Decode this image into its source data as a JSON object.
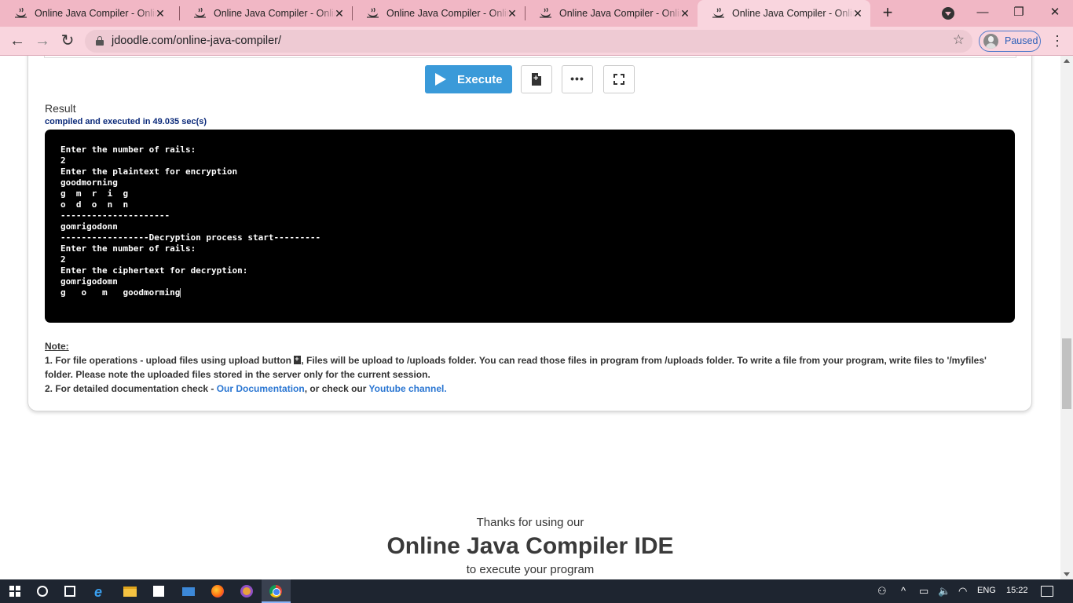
{
  "browser": {
    "tabs": [
      {
        "title": "Online Java Compiler - Online Java IDE",
        "active": false
      },
      {
        "title": "Online Java Compiler - Online Java IDE",
        "active": false
      },
      {
        "title": "Online Java Compiler - Online Java IDE",
        "active": false
      },
      {
        "title": "Online Java Compiler - Online Java IDE",
        "active": false
      },
      {
        "title": "Online Java Compiler - Online Java IDE",
        "active": true
      }
    ],
    "tab_close_glyph": "✕",
    "new_tab_glyph": "+",
    "url": "jdoodle.com/online-java-compiler/",
    "profile_status": "Paused",
    "back_glyph": "←",
    "forward_glyph": "→",
    "reload_glyph": "↻",
    "star_glyph": "☆",
    "menu_glyph": "⋮",
    "minimize_glyph": "—",
    "maximize_glyph": "❐",
    "close_glyph": "✕"
  },
  "toolbar": {
    "execute_label": "Execute",
    "more_glyph": "•••"
  },
  "result": {
    "label": "Result",
    "exec_info": "compiled and executed in 49.035 sec(s)",
    "console_lines": [
      "Enter the number of rails:",
      "2",
      "Enter the plaintext for encryption",
      "goodmorning",
      "g  m  r  i  g",
      "o  d  o  n  n",
      "---------------------",
      "gomrigodonn",
      "-----------------Decryption process start---------",
      "Enter the number of rails:",
      "2",
      "Enter the ciphertext for decryption:",
      "gomrigodomn",
      "g   o   m   goodmorming"
    ]
  },
  "note": {
    "title": "Note:",
    "line1_a": "1. For file operations - upload files using upload button ",
    "line1_b": ", Files will be upload to /uploads folder. You can read those files in program from /uploads folder. To write a file from your program, write files to '/myfiles'",
    "line2": "folder. Please note the uploaded files stored in the server only for the current session.",
    "line3_a": "2. For detailed documentation check - ",
    "line3_link1": "Our Documentation",
    "line3_b": ", or check our ",
    "line3_link2": "Youtube channel."
  },
  "footer": {
    "thanks": "Thanks for using our",
    "title": "Online Java Compiler IDE",
    "subtitle": "to execute your program"
  },
  "taskbar": {
    "lang": "ENG",
    "time": "15:22"
  },
  "colors": {
    "tab_strip": "#f1b7c5",
    "toolbar": "#f9d5de",
    "execute_button": "#3a9ad9",
    "link": "#2a76d2",
    "console_bg": "#000000"
  }
}
